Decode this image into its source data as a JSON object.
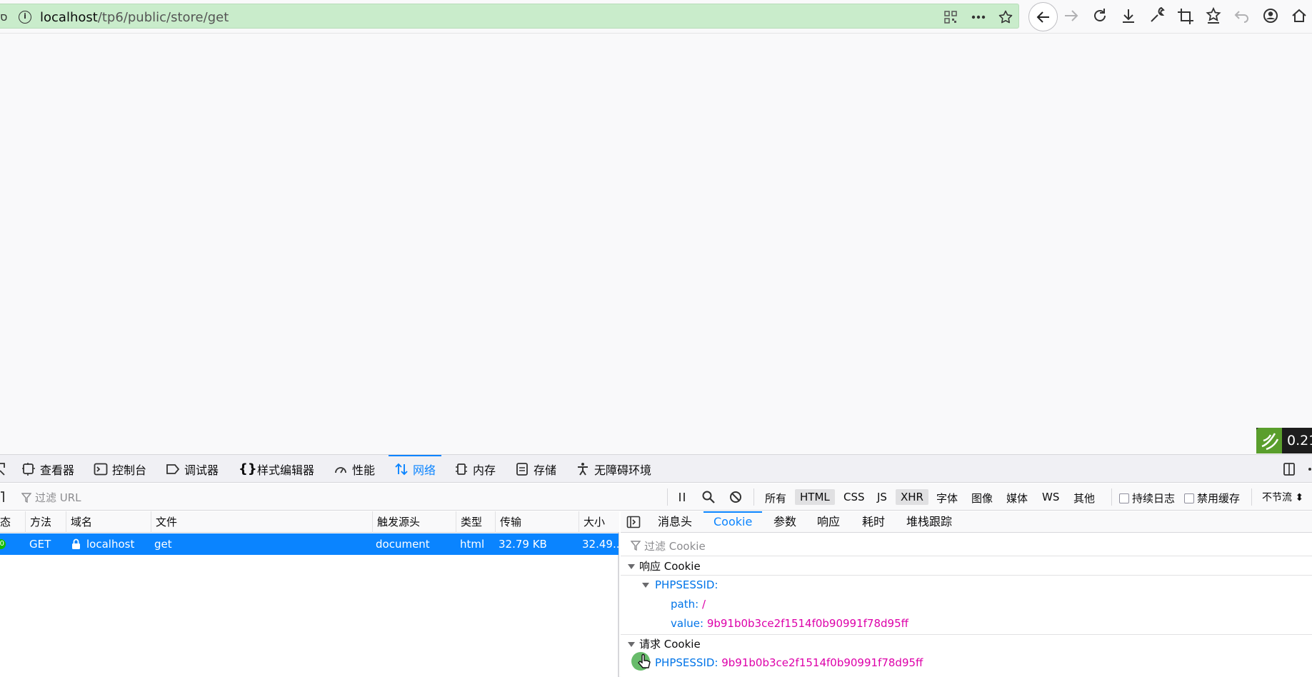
{
  "browser": {
    "url_host": "localhost",
    "url_path": "/tp6/public/store/get"
  },
  "perf_badge": {
    "value": "0.21"
  },
  "devtools": {
    "tabs": [
      {
        "label": "查看器",
        "icon": "inspector-icon"
      },
      {
        "label": "控制台",
        "icon": "console-icon"
      },
      {
        "label": "调试器",
        "icon": "debugger-icon"
      },
      {
        "label": "样式编辑器",
        "icon": "style-editor-icon"
      },
      {
        "label": "性能",
        "icon": "performance-icon"
      },
      {
        "label": "网络",
        "icon": "network-icon",
        "active": true
      },
      {
        "label": "内存",
        "icon": "memory-icon"
      },
      {
        "label": "存储",
        "icon": "storage-icon"
      },
      {
        "label": "无障碍环境",
        "icon": "accessibility-icon"
      }
    ],
    "toolbar": {
      "filter_placeholder": "过滤 URL",
      "type_filters": [
        "所有",
        "HTML",
        "CSS",
        "JS",
        "XHR",
        "字体",
        "图像",
        "媒体",
        "WS",
        "其他"
      ],
      "active_filters": [
        "HTML",
        "XHR"
      ],
      "persist_log": "持续日志",
      "disable_cache": "禁用缓存",
      "throttle": "不节流 ⬍"
    },
    "request_table": {
      "columns": [
        "态",
        "方法",
        "域名",
        "文件",
        "触发源头",
        "类型",
        "传输",
        "大小"
      ],
      "row": {
        "status": "0",
        "method": "GET",
        "domain": "localhost",
        "file": "get",
        "cause": "document",
        "type": "html",
        "transferred": "32.79 KB",
        "size": "32.49..."
      }
    },
    "side_panel": {
      "tabs": [
        "消息头",
        "Cookie",
        "参数",
        "响应",
        "耗时",
        "堆栈跟踪"
      ],
      "active_tab": "Cookie",
      "filter_placeholder": "过滤 Cookie",
      "response_cookie": {
        "heading": "响应 Cookie",
        "name": "PHPSESSID:",
        "path_key": "path:",
        "path_value": "/",
        "value_key": "value:",
        "value_value": "9b91b0b3ce2f1514f0b90991f78d95ff"
      },
      "request_cookie": {
        "heading": "请求 Cookie",
        "key": "PHPSESSID:",
        "value": "9b91b0b3ce2f1514f0b90991f78d95ff"
      }
    }
  }
}
